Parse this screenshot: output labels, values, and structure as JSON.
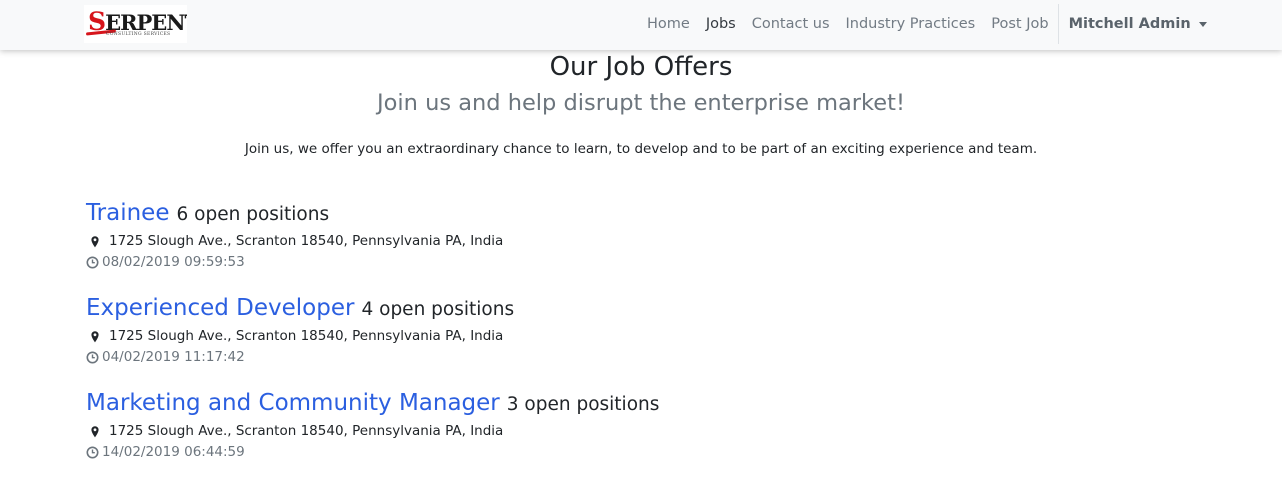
{
  "navbar": {
    "logo": {
      "initial": "S",
      "name": "ERPENT",
      "tagline": "CONSULTING SERVICES",
      "accent_color": "#d6141b"
    },
    "links": [
      {
        "label": "Home",
        "active": false
      },
      {
        "label": "Jobs",
        "active": true
      },
      {
        "label": "Contact us",
        "active": false
      },
      {
        "label": "Industry Practices",
        "active": false
      },
      {
        "label": "Post Job",
        "active": false
      }
    ],
    "user": {
      "label": "Mitchell Admin",
      "icon": "caret-down-icon"
    }
  },
  "header": {
    "title": "Our Job Offers",
    "subtitle": "Join us and help disrupt the enterprise market!",
    "intro": "Join us, we offer you an extraordinary chance to learn, to develop and to be part of an exciting experience and team."
  },
  "jobs": [
    {
      "title": "Trainee",
      "positions": "6 open positions",
      "address": "1725 Slough Ave., Scranton 18540, Pennsylvania PA, India",
      "date": "08/02/2019 09:59:53"
    },
    {
      "title": "Experienced Developer",
      "positions": "4 open positions",
      "address": "1725 Slough Ave., Scranton 18540, Pennsylvania PA, India",
      "date": "04/02/2019 11:17:42"
    },
    {
      "title": "Marketing and Community Manager",
      "positions": "3 open positions",
      "address": "1725 Slough Ave., Scranton 18540, Pennsylvania PA, India",
      "date": "14/02/2019 06:44:59"
    }
  ],
  "icons": {
    "address": "map-marker-icon",
    "date": "clock-icon"
  },
  "colors": {
    "link": "#2b5fe0",
    "muted": "#6c757d",
    "navbar_bg": "#f8f9fa"
  }
}
